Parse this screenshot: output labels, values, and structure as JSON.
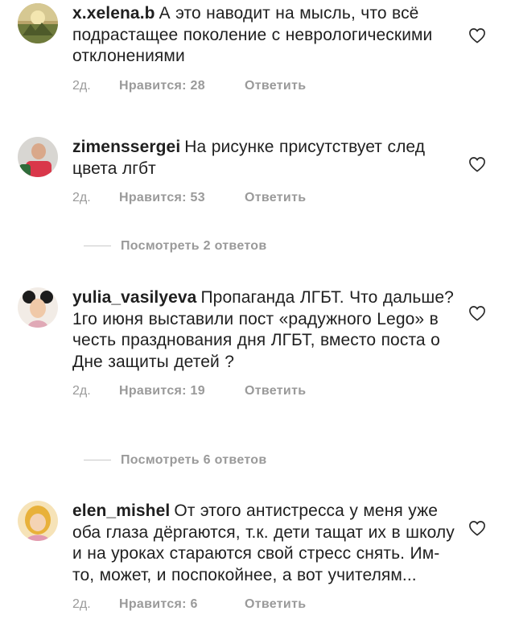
{
  "comments": [
    {
      "username": "x.xelena.b",
      "text": "А это наводит на мысль, что всё подрастащее поколение с неврологическими  отклонениями",
      "time": "2д.",
      "likes": "Нравится: 28",
      "reply": "Ответить"
    },
    {
      "username": "zimenssergei",
      "text": "На рисунке присутствует след цвета лгбт",
      "time": "2д.",
      "likes": "Нравится: 53",
      "reply": "Ответить"
    },
    {
      "username": "yulia_vasilyeva",
      "text": "Пропаганда ЛГБТ. Что дальше? 1го июня выставили пост «радужного Lego» в честь празднования дня ЛГБТ, вместо поста о Дне защиты детей ?",
      "time": "2д.",
      "likes": "Нравится: 19",
      "reply": "Ответить"
    },
    {
      "username": "elen_mishel",
      "text": "От этого антистресса у меня уже оба глаза дёргаются, т.к. дети тащат их в школу и на уроках стараются свой стресс снять. Им-то, может, и поспокойнее, а вот учителям...",
      "time": "2д.",
      "likes": "Нравится: 6",
      "reply": "Ответить"
    }
  ],
  "view_replies": [
    "Посмотреть 2 ответов",
    "Посмотреть 6 ответов"
  ],
  "icons": {
    "like": "heart-outline-icon"
  },
  "colors": {
    "text": "#1f1f1f",
    "muted": "#9a9a9a"
  }
}
